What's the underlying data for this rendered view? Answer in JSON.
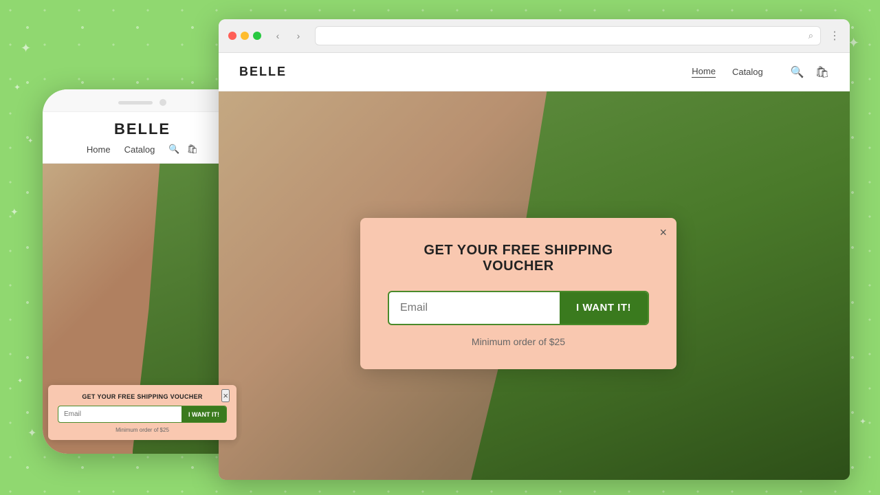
{
  "background": {
    "color": "#90d870"
  },
  "browser": {
    "dots": [
      "red",
      "yellow",
      "green"
    ],
    "nav_back": "‹",
    "nav_forward": "›",
    "menu_dots": "⋮"
  },
  "store": {
    "logo": "BELLE",
    "nav": {
      "home": "Home",
      "catalog": "Catalog"
    },
    "search_icon": "🔍",
    "cart_icon": "🛍"
  },
  "popup": {
    "title": "GET YOUR FREE SHIPPING VOUCHER",
    "email_placeholder": "Email",
    "submit_label": "I WANT IT!",
    "footnote": "Minimum order of $25",
    "close": "×"
  },
  "mobile": {
    "logo": "BELLE",
    "nav": {
      "home": "Home",
      "catalog": "Catalog"
    },
    "popup": {
      "title": "GET YOUR FREE SHIPPING VOUCHER",
      "email_placeholder": "Email",
      "submit_label": "I WANT IT!",
      "footnote": "Minimum order of $25",
      "close": "×"
    }
  }
}
